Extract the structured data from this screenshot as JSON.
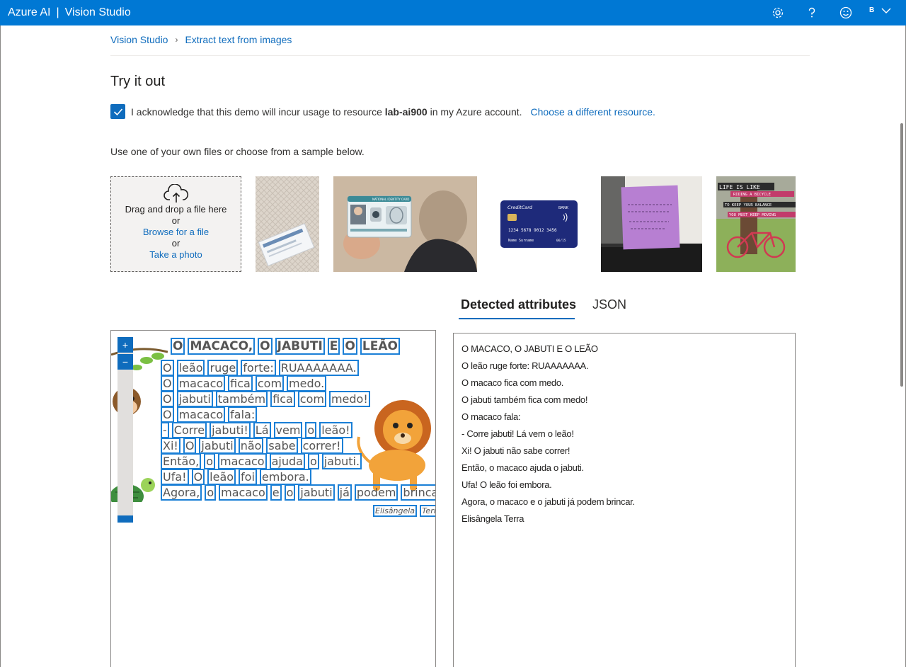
{
  "header": {
    "brand": "Azure AI",
    "product": "Vision Studio",
    "user_initial": "B",
    "icons": [
      "settings-icon",
      "help-icon",
      "feedback-icon",
      "chevron-down-icon"
    ]
  },
  "breadcrumb": {
    "root": "Vision Studio",
    "current": "Extract text from images"
  },
  "page": {
    "title": "Try it out",
    "ack_prefix": "I acknowledge that this demo will incur usage to resource",
    "ack_resource": "lab-ai900",
    "ack_suffix": "in my Azure account.",
    "ack_checked": true,
    "change_resource": "Choose a different resource.",
    "hint": "Use one of your own files or choose from a sample below."
  },
  "upload": {
    "drag": "Drag and drop a file here",
    "or1": "or",
    "browse": "Browse for a file",
    "or2": "or",
    "photo": "Take a photo"
  },
  "samples": {
    "card_title": "CreditCard",
    "card_bank": "BANK",
    "card_number": "1234 5678 9012 3456",
    "card_name": "Name Surname",
    "card_exp": "06/15",
    "id_title": "NATIONAL IDENTITY CARD",
    "poster_lines": [
      "LIFE IS LIKE",
      "RIDING A BICYCLE",
      "TO KEEP YOUR BALANCE",
      "YOU MUST KEEP MOVING"
    ]
  },
  "tabs": {
    "detected": "Detected attributes",
    "json": "JSON"
  },
  "zoom": {
    "plus": "+",
    "minus": "−"
  },
  "ocr_image": {
    "lines": [
      [
        "O",
        "MACACO,",
        "O",
        "JABUTI",
        "E",
        "O",
        "LEÃO"
      ],
      [
        "O",
        "leão",
        "ruge",
        "forte:",
        "RUAAAAAAA."
      ],
      [
        "O",
        "macaco",
        "fica",
        "com",
        "medo."
      ],
      [
        "O",
        "jabuti",
        "também",
        "fica",
        "com",
        "medo!"
      ],
      [
        "O",
        "macaco",
        "fala:"
      ],
      [
        "-",
        "Corre",
        "jabuti!",
        "Lá",
        "vem",
        "o",
        "leão!"
      ],
      [
        "Xi!",
        "O",
        "jabuti",
        "não",
        "sabe",
        "correr!"
      ],
      [
        "Então,",
        "o",
        "macaco",
        "ajuda",
        "o",
        "jabuti."
      ],
      [
        "Ufa!",
        "O",
        "leão",
        "foi",
        "embora."
      ],
      [
        "Agora,",
        "o",
        "macaco",
        "e",
        "o",
        "jabuti",
        "já",
        "podem",
        "brincar."
      ],
      [
        "Elisângela",
        "Terra"
      ]
    ]
  },
  "result_lines": [
    "O MACACO, O JABUTI E O LEÃO",
    "O leão ruge forte: RUAAAAAAA.",
    "O macaco fica com medo.",
    "O jabuti também fica com medo!",
    "O macaco fala:",
    "- Corre jabuti! Lá vem o leão!",
    "Xi! O jabuti não sabe correr!",
    "Então, o macaco ajuda o jabuti.",
    "Ufa! O leão foi embora.",
    "Agora, o macaco e o jabuti já podem brincar.",
    "Elisângela Terra"
  ],
  "colors": {
    "accent": "#0078d4",
    "link": "#0f6cbd",
    "ocr_box": "#1a7fd6"
  }
}
